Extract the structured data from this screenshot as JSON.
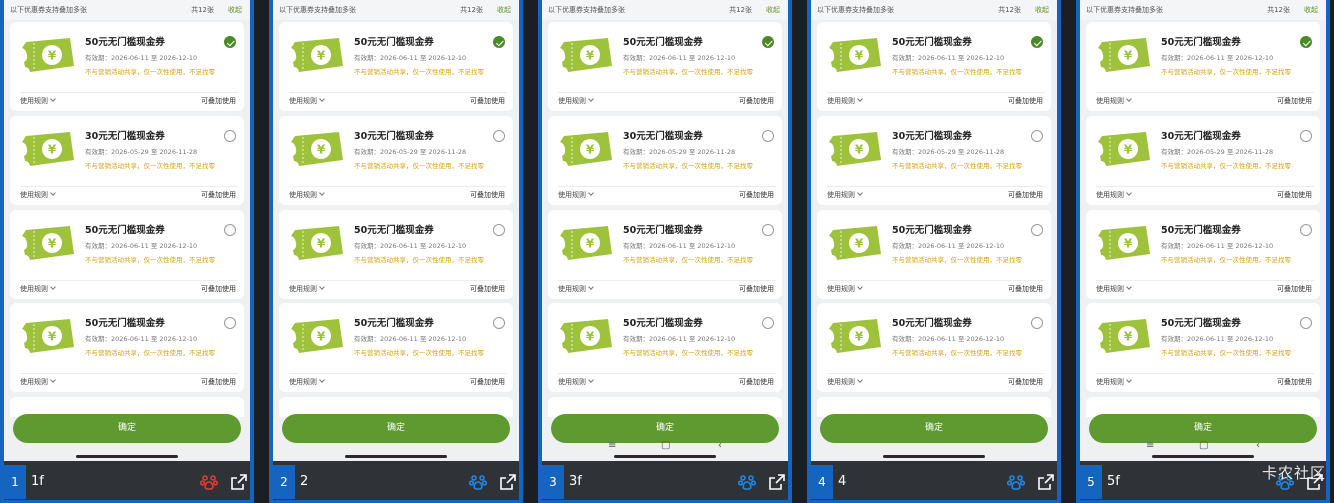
{
  "header": {
    "hint": "以下优惠券支持叠加多张",
    "count": "共12张",
    "collapse": "收起"
  },
  "coupons": [
    {
      "title": "50元无门槛现金券",
      "validity": "有效期：2026-06-11 至 2026-12-10",
      "note": "不与营销活动共享，仅一次性使用，不足找零",
      "rules": "使用规则",
      "stack": "可叠加使用"
    },
    {
      "title": "30元无门槛现金券",
      "validity": "有效期：2026-05-29 至 2026-11-28",
      "note": "不与营销活动共享，仅一次性使用，不足找零",
      "rules": "使用规则",
      "stack": "可叠加使用"
    },
    {
      "title": "50元无门槛现金券",
      "validity": "有效期：2026-06-11 至 2026-12-10",
      "note": "不与营销活动共享，仅一次性使用，不足找零",
      "rules": "使用规则",
      "stack": "可叠加使用"
    },
    {
      "title": "50元无门槛现金券",
      "validity": "有效期：2026-06-11 至 2026-12-10",
      "note": "不与营销活动共享，仅一次性使用，不足找零",
      "rules": "使用规则",
      "stack": "可叠加使用"
    }
  ],
  "confirm_label": "确定",
  "nav_keys": {
    "menu": "≡",
    "home": "▢",
    "back": "‹"
  },
  "panels": [
    {
      "number": "1",
      "label": "1f",
      "paw_color": "#e53935",
      "show_nav_keys": false
    },
    {
      "number": "2",
      "label": "2",
      "paw_color": "#1e88e5",
      "show_nav_keys": false
    },
    {
      "number": "3",
      "label": "3f",
      "paw_color": "#1e88e5",
      "show_nav_keys": true
    },
    {
      "number": "4",
      "label": "4",
      "paw_color": "#1e88e5",
      "show_nav_keys": false
    },
    {
      "number": "5",
      "label": "5f",
      "paw_color": "#1e88e5",
      "show_nav_keys": true
    }
  ],
  "selected_coupon_index": 0,
  "colors": {
    "accent": "#5e9a2f",
    "ticket": "#9fc23c",
    "note": "#d7a10e",
    "panel_border": "#1565c0"
  },
  "watermark": "卡农社区"
}
